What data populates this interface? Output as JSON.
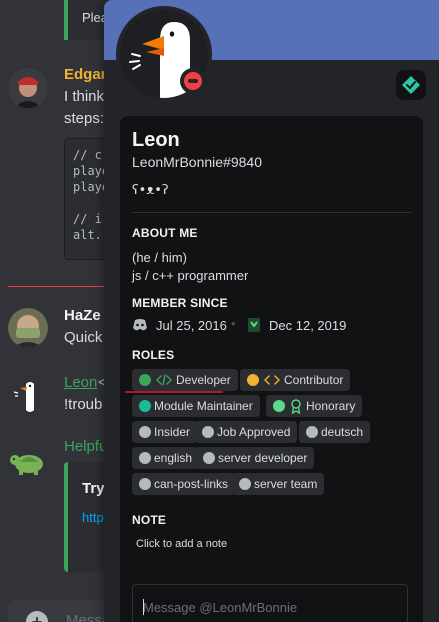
{
  "theme": {
    "banner_color": "#5771b8",
    "status_color": "#f23f43",
    "green": "#3ba55c",
    "role_colors": {
      "developer": "#3ba55c",
      "contributor": "#f0b232",
      "module_maintainer": "#1abc9c",
      "honorary": "#5bd88c",
      "default": "#b5bac1"
    }
  },
  "chat": {
    "top_snippet": "Plea",
    "messages": [
      {
        "author": "Edgara",
        "author_color": "#f0b232",
        "lines": [
          "I think",
          "steps:"
        ]
      },
      {
        "author": "HaZe",
        "author_color": "#f2f3f5",
        "lines": [
          "Quick"
        ]
      },
      {
        "author": "Leon",
        "author_color": "#3ba55c",
        "lines": [
          "!troub"
        ]
      },
      {
        "author": "Helpfu",
        "author_color": "#3ba55c",
        "lines": []
      }
    ],
    "code_lines": [
      "// c",
      "playe",
      "playe",
      "",
      "// i",
      "alt."
    ],
    "embed": {
      "title": "Try",
      "link": "http"
    },
    "composer_placeholder": "Messa",
    "reply_marker": "<"
  },
  "profile": {
    "display_name": "Leon",
    "tag": "LeonMrBonnie#9840",
    "custom_status": "ʕ•ᴥ•ʔ",
    "about_title": "ABOUT ME",
    "about_lines": [
      "(he / him)",
      "js / c++ programmer"
    ],
    "member_since_title": "MEMBER SINCE",
    "discord_since": "Jul 25, 2016",
    "server_since": "Dec 12, 2019",
    "roles_title": "ROLES",
    "roles": [
      {
        "label": "Developer",
        "icon": "code-icon"
      },
      {
        "label": "Contributor",
        "icon": "code-icon"
      },
      {
        "label": "Module Maintainer"
      },
      {
        "label": "Honorary",
        "icon": "ribbon-icon"
      },
      {
        "label": "Insider"
      },
      {
        "label": "Job Approved"
      },
      {
        "label": "deutsch"
      },
      {
        "label": "english"
      },
      {
        "label": "server developer"
      },
      {
        "label": "can-post-links"
      },
      {
        "label": "server team"
      }
    ],
    "note_title": "NOTE",
    "note_placeholder": "Click to add a note",
    "message_placeholder": "Message @LeonMrBonnie"
  }
}
